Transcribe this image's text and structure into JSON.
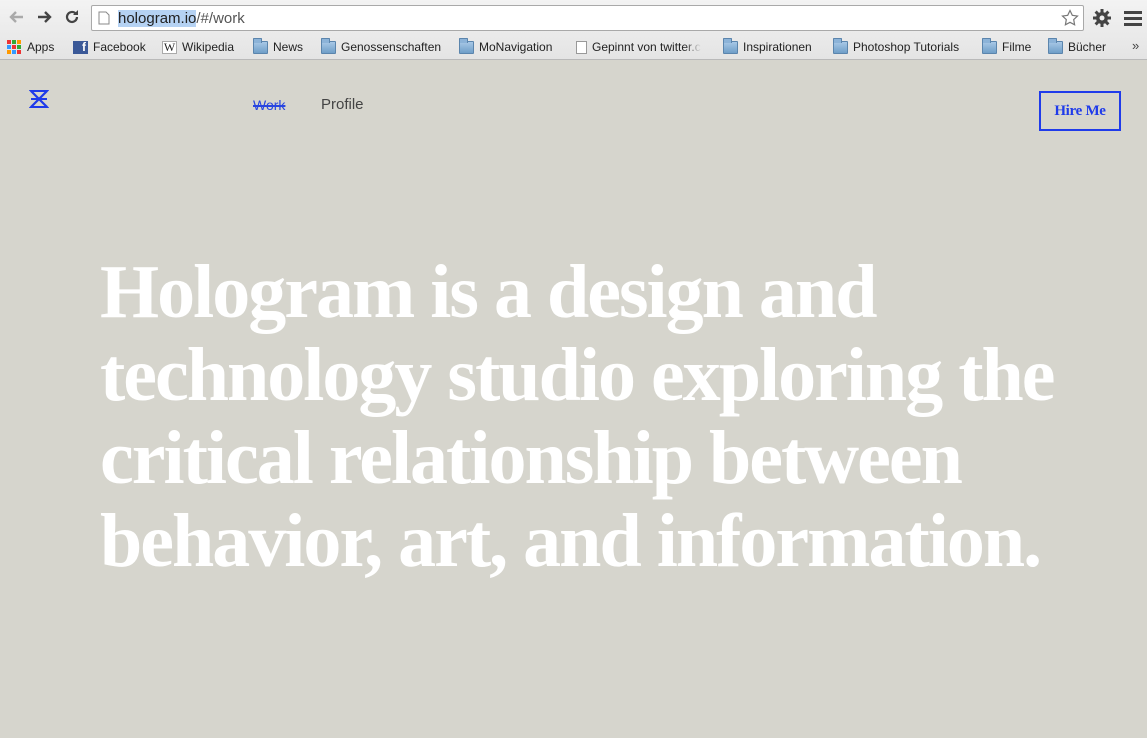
{
  "browser": {
    "url_host": "hologram.io",
    "url_rest": "/#/work",
    "bookmarks": [
      {
        "label": "Apps",
        "icon": "apps-grid-icon"
      },
      {
        "label": "Facebook",
        "icon": "facebook-icon"
      },
      {
        "label": "Wikipedia",
        "icon": "wikipedia-icon"
      },
      {
        "label": "News",
        "icon": "folder-icon"
      },
      {
        "label": "Genossenschaften",
        "icon": "folder-icon"
      },
      {
        "label": "MoNavigation",
        "icon": "folder-icon"
      },
      {
        "label": "Gepinnt von twitter.c",
        "icon": "page-icon"
      },
      {
        "label": "Inspirationen",
        "icon": "folder-icon"
      },
      {
        "label": "Photoshop Tutorials",
        "icon": "folder-icon"
      },
      {
        "label": "Filme",
        "icon": "folder-icon"
      },
      {
        "label": "Bücher",
        "icon": "folder-icon"
      }
    ],
    "more": "»"
  },
  "site": {
    "nav": {
      "work": "Work",
      "profile": "Profile"
    },
    "hire_button": "Hire Me",
    "headline": "Hologram is a design and technology studio exploring the critical relationship between behavior, art, and information.",
    "colors": {
      "accent": "#1f3bea",
      "background": "#d6d5cd",
      "headline": "#ffffff"
    }
  }
}
